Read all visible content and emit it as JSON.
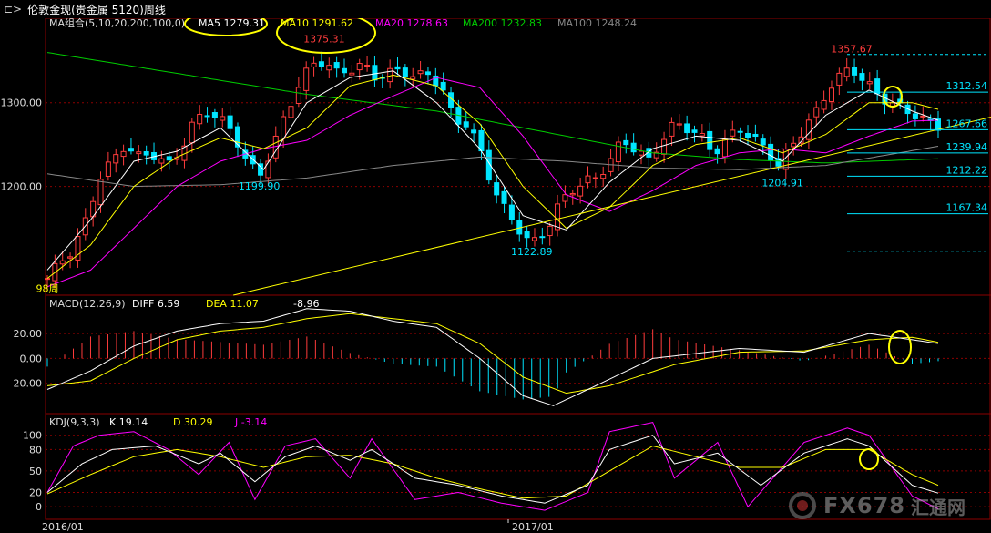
{
  "header": {
    "back_icon": "⊏>",
    "title": "伦敦金现(贵金属 5120)周线"
  },
  "watermark": {
    "text": "FX678",
    "sub": "汇通网",
    "icon": "fx678-logo"
  },
  "colors": {
    "up": "#ff3c3c",
    "down": "#00e5ff",
    "ma5": "#ffffff",
    "ma10": "#ffff00",
    "ma20": "#ff00ff",
    "ma100": "#888888",
    "ma200": "#00cc00",
    "dif": "#ffffff",
    "dea": "#ffff00",
    "k": "#ffffff",
    "d": "#ffff00",
    "j": "#ff00ff",
    "trend": "#ffff00",
    "level": "#00e5ff",
    "grid": "#8b0000",
    "highlight": "#ffff00"
  },
  "chart_data": [
    {
      "type": "candlestick",
      "panel": "main",
      "indicator_label": "MA组合(5,10,20,200,100,0)",
      "ma_labels": [
        {
          "key": "ma5",
          "text": "MA5 1279.31"
        },
        {
          "key": "ma10",
          "text": "MA10 1291.62"
        },
        {
          "key": "ma20",
          "text": "MA20 1278.63"
        },
        {
          "key": "ma200",
          "text": "MA200 1232.83"
        },
        {
          "key": "ma100",
          "text": "MA100 1248.24"
        }
      ],
      "ylabels": [
        "1300.00",
        "1200.00"
      ],
      "xlabels": [
        "2016/01",
        "2017/01"
      ],
      "ylim": [
        1070,
        1390
      ],
      "bar_count": 118,
      "candles_close_path": [
        [
          0,
          1090
        ],
        [
          3,
          1110
        ],
        [
          6,
          1125
        ],
        [
          9,
          1160
        ],
        [
          12,
          1210
        ],
        [
          15,
          1230
        ],
        [
          18,
          1250
        ],
        [
          21,
          1235
        ],
        [
          24,
          1240
        ],
        [
          28,
          1225
        ],
        [
          31,
          1245
        ],
        [
          34,
          1278
        ],
        [
          37,
          1290
        ],
        [
          40,
          1280
        ],
        [
          43,
          1265
        ],
        [
          46,
          1230
        ],
        [
          49,
          1213
        ],
        [
          52,
          1245
        ],
        [
          55,
          1285
        ],
        [
          58,
          1320
        ],
        [
          61,
          1345
        ],
        [
          64,
          1350
        ],
        [
          67,
          1335
        ],
        [
          70,
          1340
        ],
        [
          73,
          1345
        ],
        [
          76,
          1330
        ],
        [
          79,
          1335
        ],
        [
          82,
          1340
        ],
        [
          85,
          1330
        ],
        [
          88,
          1335
        ],
        [
          91,
          1320
        ],
        [
          94,
          1280
        ],
        [
          97,
          1275
        ],
        [
          100,
          1245
        ],
        [
          103,
          1200
        ],
        [
          106,
          1170
        ],
        [
          109,
          1150
        ],
        [
          112,
          1130
        ],
        [
          115,
          1145
        ],
        [
          118,
          1175
        ],
        [
          121,
          1195
        ],
        [
          124,
          1205
        ],
        [
          127,
          1210
        ],
        [
          130,
          1230
        ],
        [
          133,
          1255
        ],
        [
          136,
          1245
        ],
        [
          139,
          1230
        ],
        [
          142,
          1255
        ],
        [
          145,
          1275
        ],
        [
          148,
          1270
        ],
        [
          151,
          1260
        ],
        [
          154,
          1240
        ],
        [
          157,
          1255
        ],
        [
          160,
          1270
        ],
        [
          163,
          1258
        ],
        [
          166,
          1245
        ],
        [
          169,
          1225
        ],
        [
          172,
          1248
        ],
        [
          175,
          1270
        ],
        [
          178,
          1290
        ],
        [
          181,
          1320
        ],
        [
          184,
          1335
        ],
        [
          186,
          1342
        ],
        [
          189,
          1325
        ],
        [
          192,
          1310
        ],
        [
          195,
          1300
        ],
        [
          198,
          1292
        ],
        [
          201,
          1285
        ],
        [
          204,
          1275
        ],
        [
          206,
          1272
        ]
      ],
      "ma_paths": {
        "ma5": [
          [
            0,
            1100
          ],
          [
            10,
            1160
          ],
          [
            20,
            1230
          ],
          [
            30,
            1242
          ],
          [
            40,
            1270
          ],
          [
            50,
            1220
          ],
          [
            60,
            1300
          ],
          [
            70,
            1330
          ],
          [
            80,
            1338
          ],
          [
            90,
            1300
          ],
          [
            100,
            1245
          ],
          [
            110,
            1165
          ],
          [
            120,
            1148
          ],
          [
            130,
            1205
          ],
          [
            140,
            1245
          ],
          [
            150,
            1260
          ],
          [
            160,
            1255
          ],
          [
            170,
            1230
          ],
          [
            180,
            1285
          ],
          [
            190,
            1315
          ],
          [
            200,
            1290
          ],
          [
            206,
            1279
          ]
        ],
        "ma10": [
          [
            0,
            1090
          ],
          [
            10,
            1130
          ],
          [
            20,
            1200
          ],
          [
            30,
            1235
          ],
          [
            40,
            1258
          ],
          [
            50,
            1245
          ],
          [
            60,
            1270
          ],
          [
            70,
            1320
          ],
          [
            80,
            1333
          ],
          [
            90,
            1320
          ],
          [
            100,
            1275
          ],
          [
            110,
            1200
          ],
          [
            120,
            1150
          ],
          [
            130,
            1175
          ],
          [
            140,
            1225
          ],
          [
            150,
            1250
          ],
          [
            160,
            1258
          ],
          [
            170,
            1240
          ],
          [
            180,
            1262
          ],
          [
            190,
            1300
          ],
          [
            200,
            1300
          ],
          [
            206,
            1292
          ]
        ],
        "ma20": [
          [
            0,
            1080
          ],
          [
            10,
            1100
          ],
          [
            20,
            1150
          ],
          [
            30,
            1200
          ],
          [
            40,
            1230
          ],
          [
            50,
            1245
          ],
          [
            60,
            1255
          ],
          [
            70,
            1285
          ],
          [
            80,
            1308
          ],
          [
            90,
            1330
          ],
          [
            100,
            1318
          ],
          [
            110,
            1260
          ],
          [
            120,
            1190
          ],
          [
            130,
            1170
          ],
          [
            140,
            1195
          ],
          [
            150,
            1225
          ],
          [
            160,
            1240
          ],
          [
            170,
            1245
          ],
          [
            180,
            1240
          ],
          [
            190,
            1260
          ],
          [
            200,
            1278
          ],
          [
            206,
            1279
          ]
        ],
        "ma100": [
          [
            0,
            1215
          ],
          [
            20,
            1200
          ],
          [
            40,
            1202
          ],
          [
            60,
            1210
          ],
          [
            80,
            1225
          ],
          [
            100,
            1235
          ],
          [
            120,
            1230
          ],
          [
            140,
            1222
          ],
          [
            160,
            1220
          ],
          [
            180,
            1225
          ],
          [
            206,
            1248
          ]
        ],
        "ma200": [
          [
            0,
            1360
          ],
          [
            30,
            1335
          ],
          [
            60,
            1310
          ],
          [
            90,
            1290
          ],
          [
            110,
            1270
          ],
          [
            140,
            1240
          ],
          [
            160,
            1232
          ],
          [
            180,
            1228
          ],
          [
            206,
            1233
          ]
        ]
      },
      "annotations": [
        {
          "text": "1375.31",
          "x": 64,
          "y": 1372,
          "color": "up"
        },
        {
          "text": "1357.67",
          "x": 186,
          "y": 1360,
          "color": "up"
        },
        {
          "text": "1199.90",
          "x": 49,
          "y": 1196,
          "color": "down"
        },
        {
          "text": "1122.89",
          "x": 112,
          "y": 1118,
          "color": "down"
        },
        {
          "text": "1204.91",
          "x": 170,
          "y": 1200,
          "color": "down"
        },
        {
          "text": "98周",
          "x": 0,
          "y": 1074,
          "color": "ma10"
        }
      ],
      "levels": [
        {
          "value": 1357.67,
          "label": "",
          "dashed": true
        },
        {
          "value": 1312.54,
          "label": "1312.54",
          "dashed": false
        },
        {
          "value": 1267.66,
          "label": "1267.66",
          "dashed": false
        },
        {
          "value": 1239.94,
          "label": "1239.94",
          "dashed": false
        },
        {
          "value": 1212.22,
          "label": "1212.22",
          "dashed": false
        },
        {
          "value": 1167.34,
          "label": "1167.34",
          "dashed": false
        },
        {
          "value": 1122.46,
          "label": "",
          "dashed": true
        }
      ],
      "trendline": [
        [
          43,
          1070
        ],
        [
          206,
          1268
        ]
      ]
    },
    {
      "type": "macd",
      "panel": "macd",
      "label": "MACD(12,26,9)",
      "diff": "DIFF 6.59",
      "dea": "DEA 11.07",
      "macd": "-8.96",
      "ylabels": [
        "20.00",
        "0.00",
        "-20.00"
      ],
      "ylim": [
        -40,
        45
      ],
      "dif_path": [
        [
          0,
          -25
        ],
        [
          10,
          -10
        ],
        [
          20,
          10
        ],
        [
          30,
          22
        ],
        [
          40,
          28
        ],
        [
          50,
          30
        ],
        [
          60,
          40
        ],
        [
          70,
          38
        ],
        [
          80,
          30
        ],
        [
          90,
          25
        ],
        [
          100,
          0
        ],
        [
          110,
          -30
        ],
        [
          117,
          -38
        ],
        [
          125,
          -25
        ],
        [
          140,
          0
        ],
        [
          160,
          8
        ],
        [
          175,
          5
        ],
        [
          190,
          20
        ],
        [
          200,
          15
        ],
        [
          206,
          12
        ]
      ],
      "dea_path": [
        [
          0,
          -22
        ],
        [
          10,
          -18
        ],
        [
          20,
          0
        ],
        [
          30,
          15
        ],
        [
          40,
          22
        ],
        [
          50,
          25
        ],
        [
          60,
          32
        ],
        [
          70,
          36
        ],
        [
          80,
          32
        ],
        [
          90,
          28
        ],
        [
          100,
          12
        ],
        [
          110,
          -15
        ],
        [
          120,
          -28
        ],
        [
          130,
          -22
        ],
        [
          145,
          -5
        ],
        [
          160,
          5
        ],
        [
          175,
          6
        ],
        [
          190,
          15
        ],
        [
          200,
          17
        ],
        [
          206,
          13
        ]
      ]
    },
    {
      "type": "kdj",
      "panel": "kdj",
      "label": "KDJ(9,3,3)",
      "k": "K 19.14",
      "d": "D 30.29",
      "j": "J -3.14",
      "ylabels": [
        "100",
        "80",
        "50",
        "20",
        "0"
      ],
      "ylim": [
        -10,
        120
      ],
      "k_path": [
        [
          0,
          20
        ],
        [
          8,
          60
        ],
        [
          15,
          80
        ],
        [
          25,
          85
        ],
        [
          35,
          60
        ],
        [
          40,
          75
        ],
        [
          48,
          35
        ],
        [
          55,
          70
        ],
        [
          62,
          85
        ],
        [
          70,
          65
        ],
        [
          75,
          80
        ],
        [
          85,
          40
        ],
        [
          95,
          30
        ],
        [
          105,
          15
        ],
        [
          115,
          5
        ],
        [
          125,
          30
        ],
        [
          130,
          80
        ],
        [
          140,
          100
        ],
        [
          145,
          60
        ],
        [
          155,
          75
        ],
        [
          165,
          30
        ],
        [
          175,
          75
        ],
        [
          185,
          95
        ],
        [
          190,
          85
        ],
        [
          200,
          30
        ],
        [
          206,
          19
        ]
      ],
      "d_path": [
        [
          0,
          18
        ],
        [
          10,
          45
        ],
        [
          20,
          70
        ],
        [
          30,
          80
        ],
        [
          40,
          70
        ],
        [
          50,
          55
        ],
        [
          60,
          70
        ],
        [
          70,
          72
        ],
        [
          80,
          60
        ],
        [
          90,
          40
        ],
        [
          100,
          25
        ],
        [
          110,
          12
        ],
        [
          120,
          15
        ],
        [
          130,
          50
        ],
        [
          140,
          85
        ],
        [
          150,
          70
        ],
        [
          160,
          55
        ],
        [
          170,
          55
        ],
        [
          180,
          80
        ],
        [
          190,
          80
        ],
        [
          200,
          45
        ],
        [
          206,
          30
        ]
      ],
      "j_path": [
        [
          0,
          20
        ],
        [
          6,
          85
        ],
        [
          12,
          100
        ],
        [
          20,
          105
        ],
        [
          28,
          80
        ],
        [
          35,
          45
        ],
        [
          42,
          90
        ],
        [
          48,
          10
        ],
        [
          55,
          85
        ],
        [
          62,
          95
        ],
        [
          70,
          40
        ],
        [
          75,
          95
        ],
        [
          85,
          10
        ],
        [
          95,
          20
        ],
        [
          105,
          5
        ],
        [
          115,
          -5
        ],
        [
          125,
          20
        ],
        [
          130,
          105
        ],
        [
          140,
          118
        ],
        [
          145,
          40
        ],
        [
          155,
          90
        ],
        [
          162,
          0
        ],
        [
          175,
          90
        ],
        [
          185,
          110
        ],
        [
          190,
          100
        ],
        [
          200,
          15
        ],
        [
          206,
          -3
        ]
      ]
    }
  ]
}
